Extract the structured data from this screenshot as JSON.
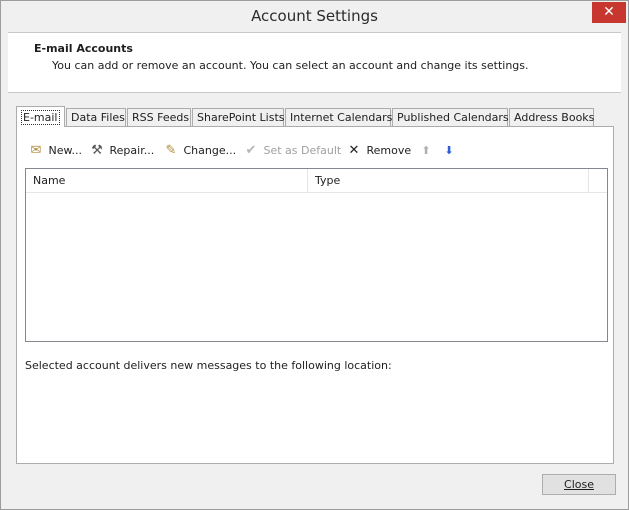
{
  "window": {
    "title": "Account Settings",
    "close_glyph": "✕"
  },
  "header": {
    "title": "E-mail Accounts",
    "description": "You can add or remove an account. You can select an account and change its settings."
  },
  "tabs": [
    {
      "label": "E-mail",
      "active": true
    },
    {
      "label": "Data Files"
    },
    {
      "label": "RSS Feeds"
    },
    {
      "label": "SharePoint Lists"
    },
    {
      "label": "Internet Calendars"
    },
    {
      "label": "Published Calendars"
    },
    {
      "label": "Address Books"
    }
  ],
  "toolbar": {
    "new": {
      "label": "New...",
      "icon": "new-account-icon"
    },
    "repair": {
      "label": "Repair...",
      "icon": "repair-tools-icon"
    },
    "change": {
      "label": "Change...",
      "icon": "change-account-icon"
    },
    "set_default": {
      "label": "Set as Default",
      "icon": "checkmark-icon",
      "disabled": true
    },
    "remove": {
      "label": "Remove",
      "icon": "x-icon"
    },
    "move_up": {
      "icon": "arrow-up-icon"
    },
    "move_down": {
      "icon": "arrow-down-icon"
    }
  },
  "list": {
    "columns": [
      "Name",
      "Type"
    ]
  },
  "location_text": "Selected account delivers new messages to the following location:",
  "footer": {
    "close_label": "Close"
  },
  "colors": {
    "accent_close": "#c7372f",
    "arrow_down": "#2a5fd6"
  }
}
